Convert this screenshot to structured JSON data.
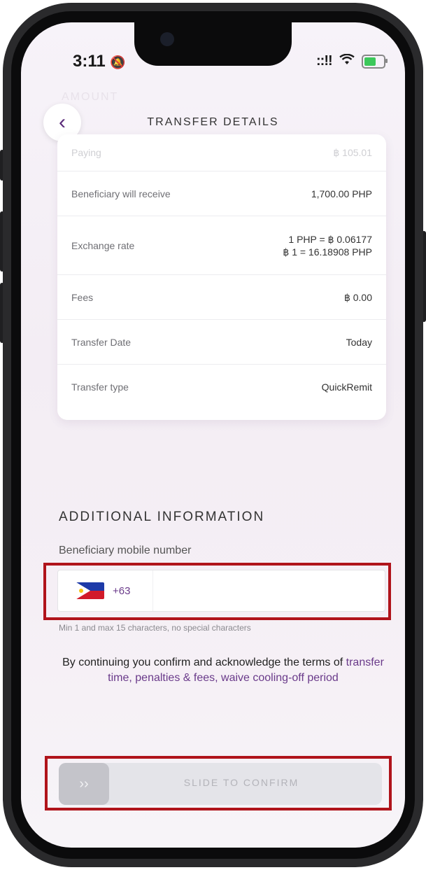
{
  "status": {
    "time": "3:11",
    "signal": "::!!"
  },
  "header": {
    "title": "TRANSFER DETAILS",
    "ghost": "AMOUNT"
  },
  "details": [
    {
      "label": "Paying",
      "value": "฿ 105.01"
    },
    {
      "label": "Beneficiary will receive",
      "value": "1,700.00 PHP"
    },
    {
      "label": "Exchange rate",
      "value": "1 PHP = ฿ 0.06177",
      "value2": "฿ 1 = 16.18908 PHP"
    },
    {
      "label": "Fees",
      "value": "฿ 0.00"
    },
    {
      "label": "Transfer Date",
      "value": "Today"
    },
    {
      "label": "Transfer type",
      "value": "QuickRemit"
    }
  ],
  "additional": {
    "heading": "ADDITIONAL INFORMATION",
    "field_label": "Beneficiary mobile number",
    "country_code": "+63",
    "phone_value": "",
    "hint": "Min 1 and max 15 characters, no special characters"
  },
  "terms": {
    "prefix": "By continuing you confirm and acknowledge the terms of",
    "link": "transfer time, penalties & fees, waive cooling-off period"
  },
  "slider": {
    "knob": "›› ",
    "label": "SLIDE TO CONFIRM"
  },
  "colors": {
    "accent": "#6a3a8a",
    "highlight": "#b0141b"
  }
}
